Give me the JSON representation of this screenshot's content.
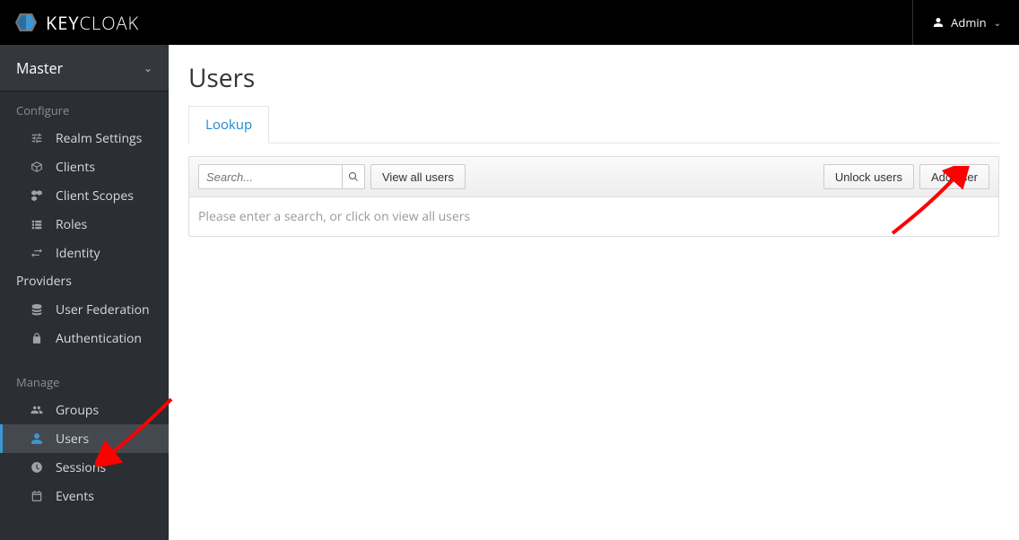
{
  "header": {
    "brand_main": "KEY",
    "brand_sub": "CLOAK",
    "user_label": "Admin"
  },
  "sidebar": {
    "realm": "Master",
    "sections": [
      {
        "title": "Configure",
        "items": [
          {
            "label": "Realm Settings",
            "icon": "sliders-icon"
          },
          {
            "label": "Clients",
            "icon": "cube-icon"
          },
          {
            "label": "Client Scopes",
            "icon": "cubes-icon"
          },
          {
            "label": "Roles",
            "icon": "list-icon"
          },
          {
            "label": "Identity",
            "icon": "exchange-icon"
          }
        ],
        "plain": "Providers",
        "items2": [
          {
            "label": "User Federation",
            "icon": "database-icon"
          },
          {
            "label": "Authentication",
            "icon": "lock-icon"
          }
        ]
      },
      {
        "title": "Manage",
        "items": [
          {
            "label": "Groups",
            "icon": "users-icon"
          },
          {
            "label": "Users",
            "icon": "user-icon",
            "active": true
          },
          {
            "label": "Sessions",
            "icon": "clock-icon"
          },
          {
            "label": "Events",
            "icon": "calendar-icon"
          }
        ]
      }
    ]
  },
  "main": {
    "title": "Users",
    "tab": "Lookup",
    "search_placeholder": "Search...",
    "view_all": "View all users",
    "unlock": "Unlock users",
    "add_user": "Add user",
    "instruction": "Please enter a search, or click on view all users"
  }
}
